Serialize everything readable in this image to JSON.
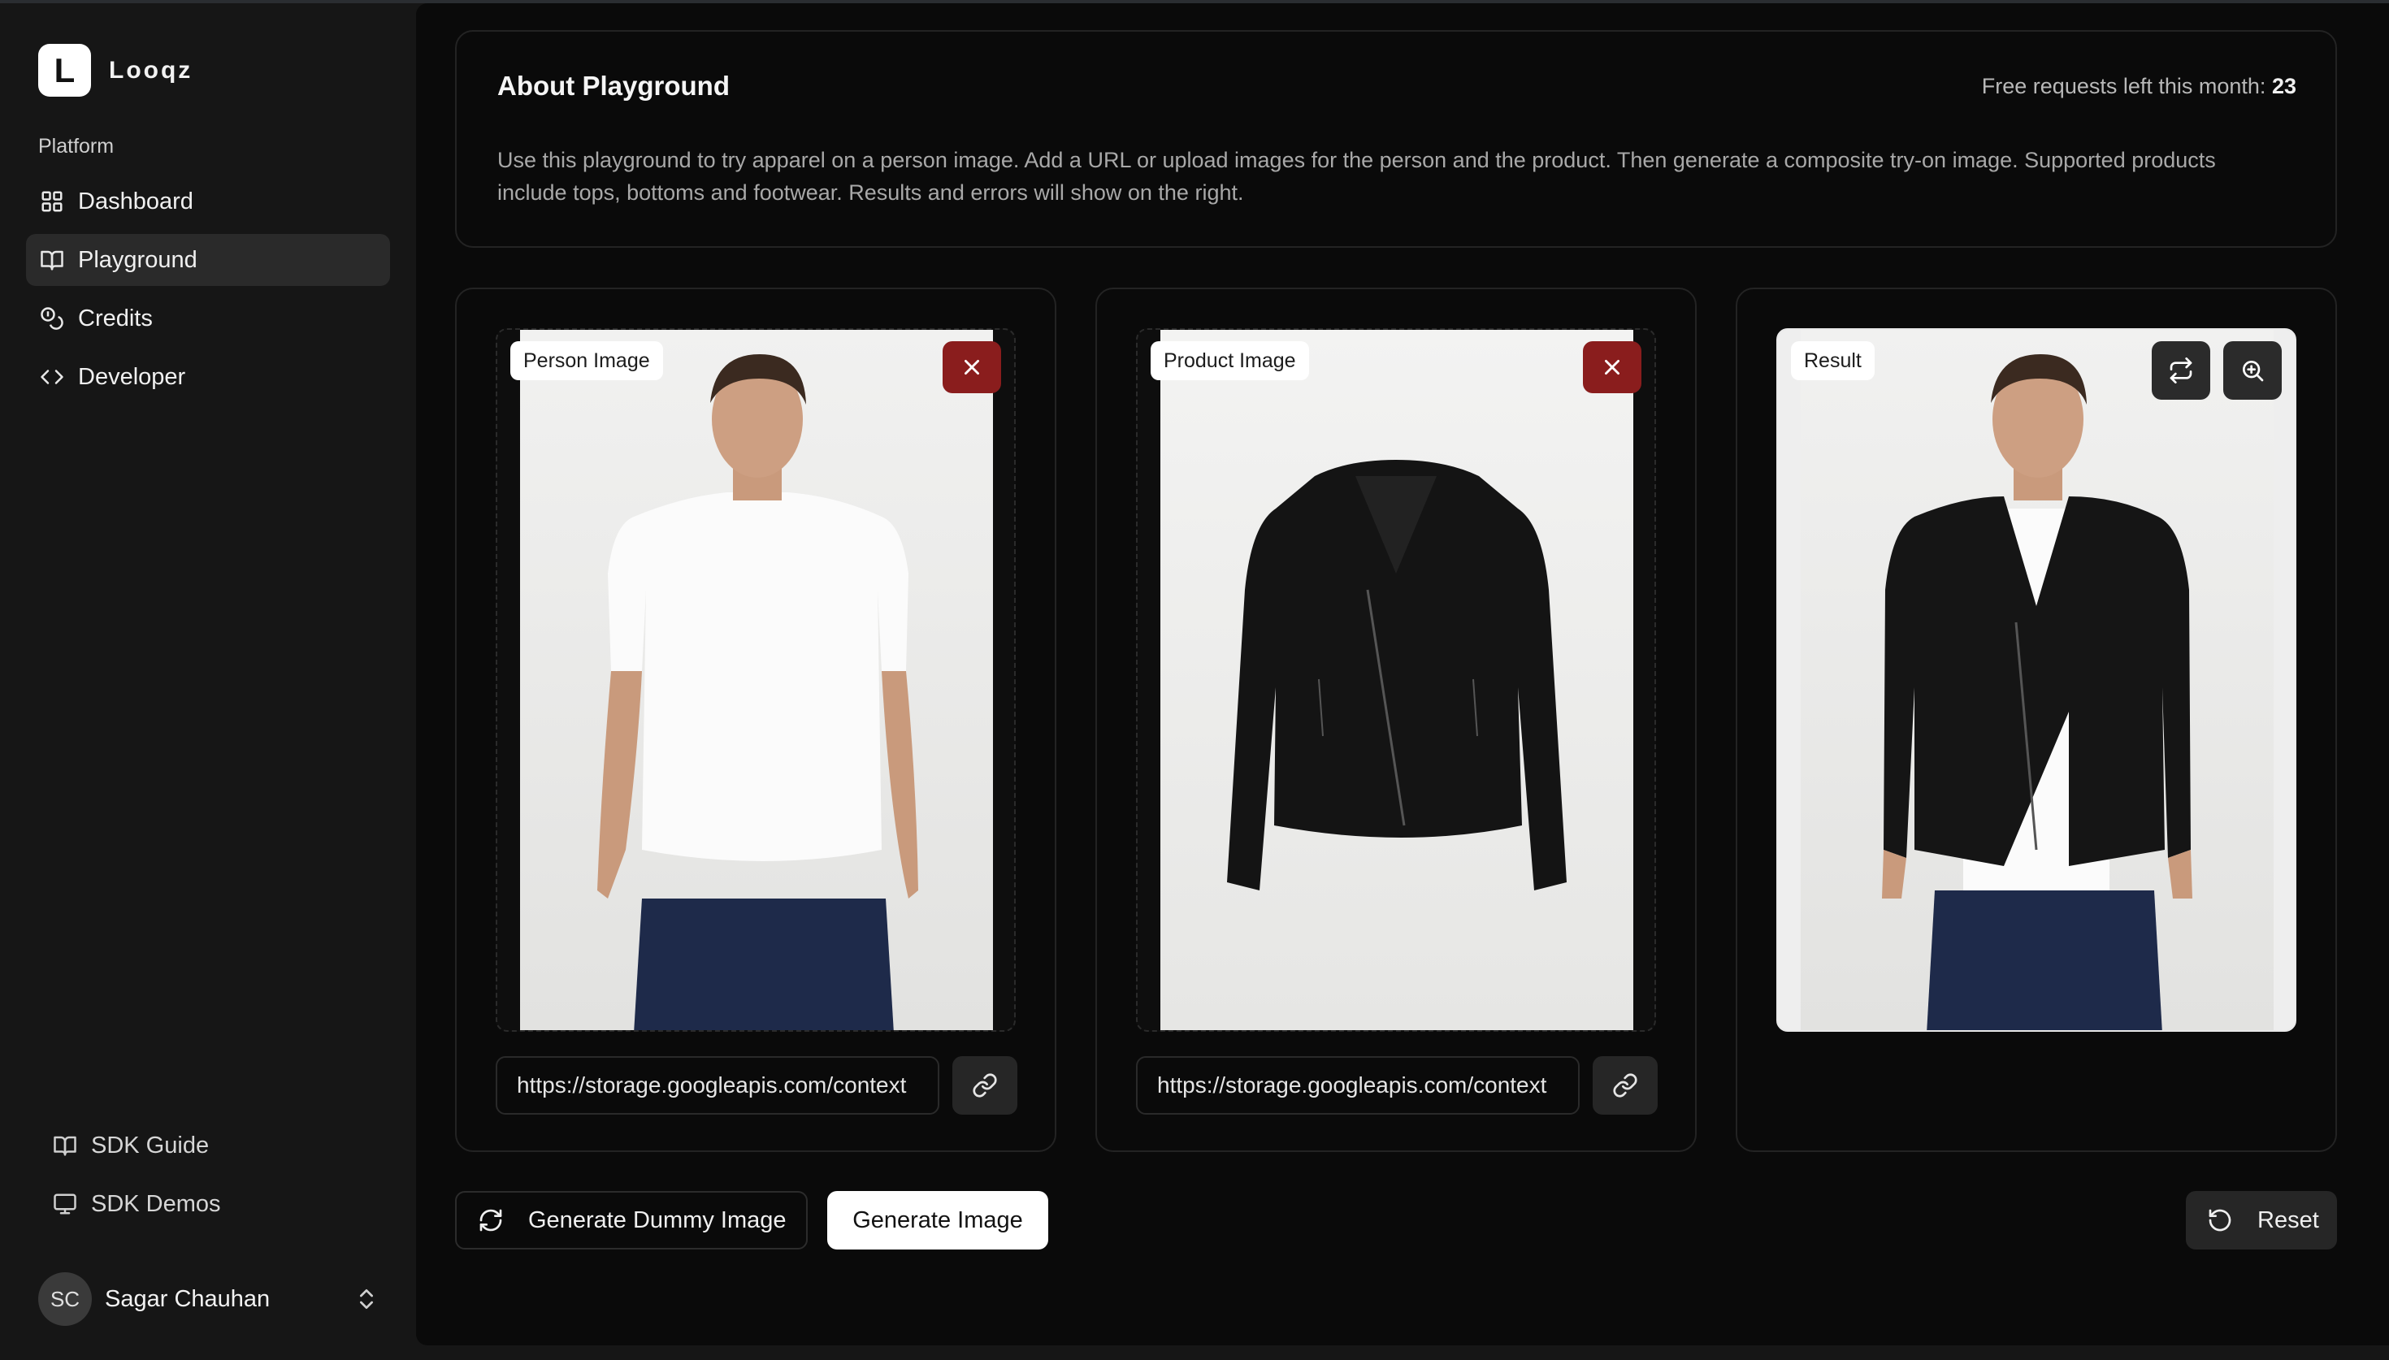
{
  "brand": {
    "logo_letter": "L",
    "name": "Looqz"
  },
  "sidebar": {
    "section_label": "Platform",
    "items": [
      {
        "label": "Dashboard",
        "icon": "grid-icon",
        "active": false
      },
      {
        "label": "Playground",
        "icon": "book-open-icon",
        "active": true
      },
      {
        "label": "Credits",
        "icon": "coins-icon",
        "active": false
      },
      {
        "label": "Developer",
        "icon": "code-icon",
        "active": false
      }
    ],
    "bottom_items": [
      {
        "label": "SDK Guide",
        "icon": "book-open-icon"
      },
      {
        "label": "SDK Demos",
        "icon": "monitor-icon"
      }
    ],
    "user": {
      "initials": "SC",
      "name": "Sagar Chauhan"
    }
  },
  "about": {
    "title": "About Playground",
    "credits_label": "Free requests left this month:",
    "credits_value": "23",
    "description": "Use this playground to try apparel on a person image. Add a URL or upload images for the person and the product. Then generate a composite try-on image. Supported products include tops, bottoms and footwear. Results and errors will show on the right."
  },
  "panels": {
    "person": {
      "tag": "Person Image",
      "url": "https://storage.googleapis.com/context"
    },
    "product": {
      "tag": "Product Image",
      "url": "https://storage.googleapis.com/context"
    },
    "result": {
      "tag": "Result"
    }
  },
  "actions": {
    "dummy_label": "Generate Dummy Image",
    "generate_label": "Generate Image",
    "reset_label": "Reset"
  },
  "colors": {
    "accent": "#ffffff",
    "remove_button": "#8a1d1d",
    "background": "#0a0a0a",
    "sidebar": "#161616"
  }
}
